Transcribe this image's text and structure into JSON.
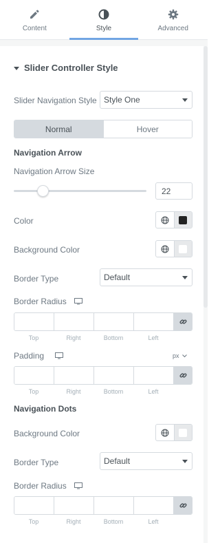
{
  "tabs": [
    {
      "label": "Content",
      "icon": "pencil-icon"
    },
    {
      "label": "Style",
      "icon": "half-circle-icon"
    },
    {
      "label": "Advanced",
      "icon": "gear-icon"
    }
  ],
  "active_tab": "Style",
  "section": {
    "title": "Slider Controller Style"
  },
  "nav_style": {
    "label": "Slider Navigation Style",
    "value": "Style One"
  },
  "state_toggle": {
    "normal": "Normal",
    "hover": "Hover"
  },
  "navigation_arrow": {
    "heading": "Navigation Arrow",
    "size_label": "Navigation Arrow Size",
    "size_value": "22",
    "size_fraction": 0.22,
    "color_label": "Color",
    "color_value": "#222222",
    "bg_color_label": "Background Color",
    "bg_color_value": "#ffffff",
    "border_type_label": "Border Type",
    "border_type_value": "Default",
    "border_radius_label": "Border Radius",
    "padding_label": "Padding",
    "padding_unit": "px"
  },
  "dimension_labels": [
    "Top",
    "Right",
    "Bottom",
    "Left"
  ],
  "navigation_dots": {
    "heading": "Navigation Dots",
    "bg_color_label": "Background Color",
    "bg_color_value": "#ffffff",
    "border_type_label": "Border Type",
    "border_type_value": "Default",
    "border_radius_label": "Border Radius"
  },
  "colors": {
    "accent": "#71a5e3"
  }
}
